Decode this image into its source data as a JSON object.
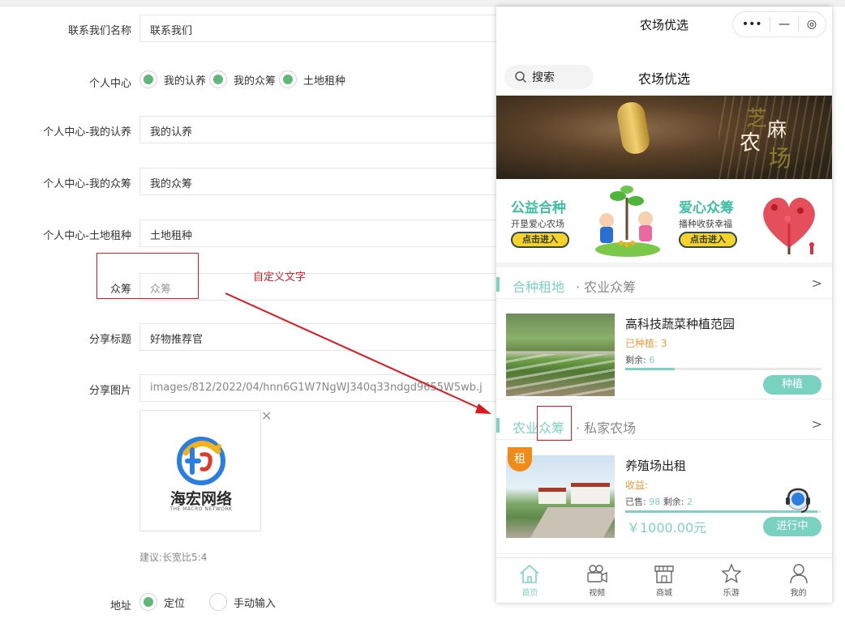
{
  "form": {
    "contact": {
      "label": "联系我们名称",
      "value": "联系我们"
    },
    "personal": {
      "label": "个人中心",
      "options": [
        {
          "text": "我的认养",
          "checked": true
        },
        {
          "text": "我的众筹",
          "checked": true
        },
        {
          "text": "土地租种",
          "checked": true
        }
      ]
    },
    "adopt": {
      "label": "个人中心-我的认养",
      "value": "我的认养"
    },
    "crowd": {
      "label": "个人中心-我的众筹",
      "value": "我的众筹"
    },
    "land": {
      "label": "个人中心-土地租种",
      "value": "土地租种"
    },
    "zhongchou": {
      "label": "众筹",
      "placeholder": "众筹"
    },
    "custom_note": "自定义文字",
    "share_title": {
      "label": "分享标题",
      "value": "好物推荐官"
    },
    "share_image": {
      "label": "分享图片",
      "value": "images/812/2022/04/hnn6G1W7NgWJ340q33ndgd9655W5wb.j",
      "logo_cn": "海宏网络",
      "logo_en": "THE MACRO NETWORK",
      "hint": "建议:长宽比5:4"
    },
    "address": {
      "label": "地址",
      "options": [
        {
          "text": "定位",
          "checked": true
        },
        {
          "text": "手动输入",
          "checked": false
        }
      ]
    }
  },
  "phone": {
    "nav_title": "农场优选",
    "capsule": {
      "more": "•••",
      "minus": "—",
      "target": "◎"
    },
    "search_label": "搜索",
    "page_title": "农场优选",
    "banner": {
      "logo_chars": [
        "芝",
        "麻",
        "农",
        "场"
      ]
    },
    "promos": [
      {
        "title": "公益合种",
        "subtitle": "开垦爱心农场",
        "button": "点击进入"
      },
      {
        "title": "爱心众筹",
        "subtitle": "播种收获幸福",
        "button": "点击进入"
      }
    ],
    "section1": {
      "title_active": "合种租地",
      "title_other": "· 农业众筹",
      "more": ">"
    },
    "card1": {
      "title": "高科技蔬菜种植范园",
      "planted_label": "已种植:",
      "planted_value": "3",
      "remain_label": "剩余:",
      "remain_value": "6",
      "progress": 0.25,
      "button": "种植"
    },
    "section2": {
      "title_active": "农业众筹",
      "title_other": "· 私家农场",
      "more": ">"
    },
    "card2": {
      "badge": "租",
      "title": "养殖场出租",
      "income_label": "收益:",
      "sold_label": "已售:",
      "sold_value": "98",
      "remain_label": "剩余:",
      "remain_value": "2",
      "progress": 0.98,
      "price": "￥1000.00元",
      "button": "进行中"
    },
    "tabs": [
      {
        "label": "首页",
        "icon": "home-icon",
        "active": true
      },
      {
        "label": "视频",
        "icon": "video-camera-icon",
        "active": false
      },
      {
        "label": "商城",
        "icon": "shop-icon",
        "active": false
      },
      {
        "label": "乐游",
        "icon": "star-icon",
        "active": false
      },
      {
        "label": "我的",
        "icon": "user-icon",
        "active": false
      }
    ]
  },
  "colors": {
    "accent": "#7dd3c0",
    "radio_on": "#5fb878",
    "annotation": "#e0191f",
    "orange": "#f29a3c"
  }
}
